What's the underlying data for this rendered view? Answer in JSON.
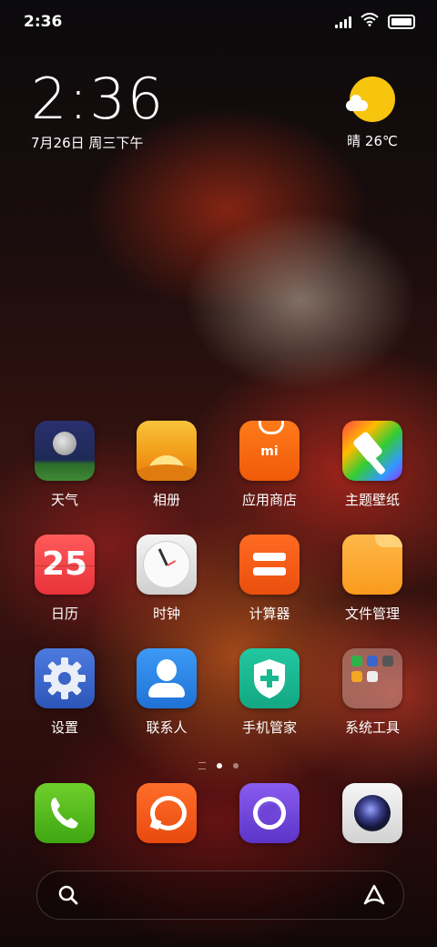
{
  "status_bar": {
    "time": "2:36",
    "icons": [
      "signal-icon",
      "wifi-icon",
      "battery-icon"
    ]
  },
  "clock_widget": {
    "time": "2:36",
    "date": "7月26日 周三下午"
  },
  "weather_widget": {
    "condition": "晴",
    "temperature": "26℃",
    "icon": "sunny-cloud-icon"
  },
  "apps": [
    {
      "label": "天气",
      "icon": "weather-app-icon"
    },
    {
      "label": "相册",
      "icon": "gallery-app-icon"
    },
    {
      "label": "应用商店",
      "icon": "app-store-icon"
    },
    {
      "label": "主题壁纸",
      "icon": "themes-app-icon"
    },
    {
      "label": "日历",
      "icon": "calendar-app-icon",
      "badge": "25"
    },
    {
      "label": "时钟",
      "icon": "clock-app-icon"
    },
    {
      "label": "计算器",
      "icon": "calculator-app-icon"
    },
    {
      "label": "文件管理",
      "icon": "file-manager-icon"
    },
    {
      "label": "设置",
      "icon": "settings-app-icon"
    },
    {
      "label": "联系人",
      "icon": "contacts-app-icon"
    },
    {
      "label": "手机管家",
      "icon": "security-app-icon"
    },
    {
      "label": "系统工具",
      "icon": "system-tools-folder-icon"
    }
  ],
  "app_store_logo": "mi",
  "page_indicator": {
    "pages": 2,
    "current": 1
  },
  "dock": [
    {
      "icon": "phone-app-icon"
    },
    {
      "icon": "messages-app-icon"
    },
    {
      "icon": "browser-app-icon"
    },
    {
      "icon": "camera-app-icon"
    }
  ],
  "search_bar": {
    "icon": "search-icon",
    "assistant_icon": "assistant-icon"
  }
}
